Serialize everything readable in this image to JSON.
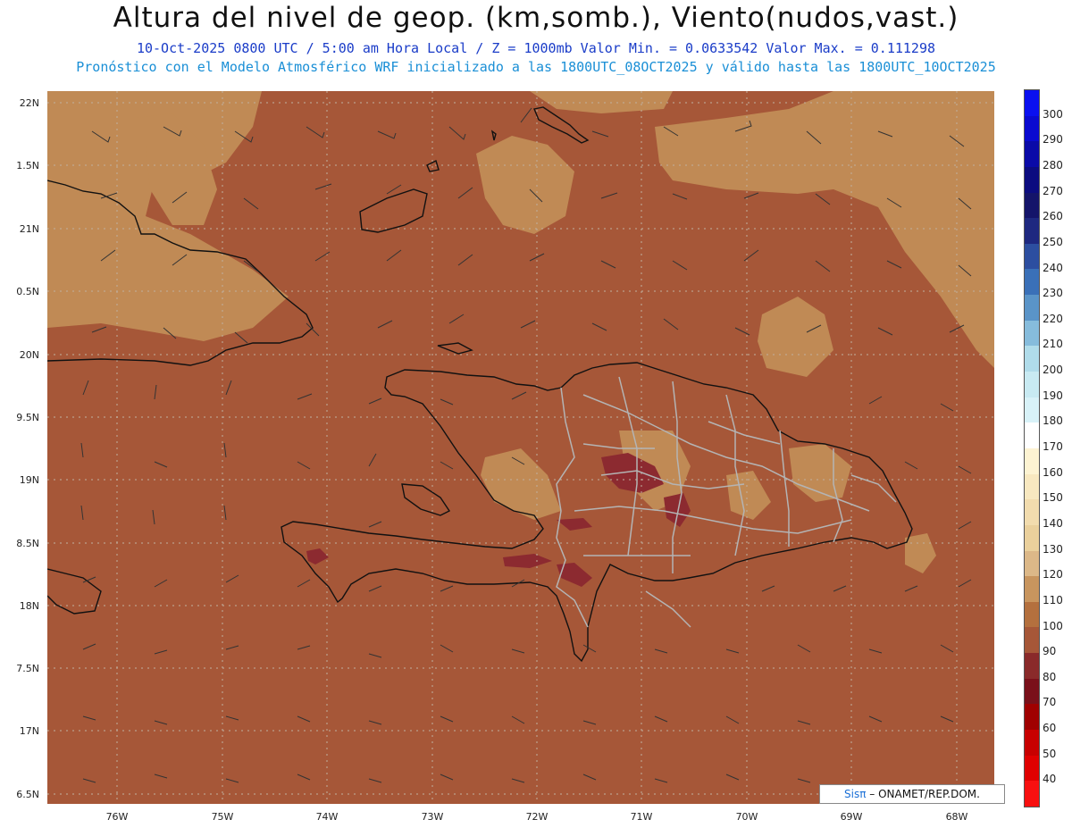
{
  "header": {
    "title": "Altura del nivel de geop. (km,somb.), Viento(nudos,vast.)",
    "subtitle_1": "10-Oct-2025  0800 UTC / 5:00 am Hora Local / Z = 1000mb  Valor Min. = 0.0633542  Valor Max. = 0.111298",
    "subtitle_2": "Pronóstico con el Modelo Atmosférico WRF inicializado a las 1800UTC_08OCT2025 y válido hasta las  1800UTC_10OCT2025"
  },
  "axes": {
    "lat_labels": [
      "22N",
      "1.5N",
      "21N",
      "0.5N",
      "20N",
      "9.5N",
      "19N",
      "8.5N",
      "18N",
      "7.5N",
      "17N",
      "6.5N"
    ],
    "lon_labels": [
      "76W",
      "75W",
      "74W",
      "73W",
      "72W",
      "71W",
      "70W",
      "69W",
      "68W"
    ]
  },
  "colorbar": {
    "labels": [
      "300",
      "290",
      "280",
      "270",
      "260",
      "250",
      "240",
      "230",
      "220",
      "210",
      "200",
      "190",
      "180",
      "170",
      "160",
      "150",
      "140",
      "130",
      "120",
      "110",
      "100",
      "90",
      "80",
      "70",
      "60",
      "50",
      "40"
    ],
    "colors": [
      "#0a10f0",
      "#0a0ad0",
      "#0a0aa8",
      "#0c0c80",
      "#14146a",
      "#1e2880",
      "#2c4ea0",
      "#3a70b8",
      "#5a94c8",
      "#86bcdc",
      "#b0dcea",
      "#c8eaf2",
      "#d8f2f8",
      "#ffffff",
      "#fdf3d2",
      "#f8e8c0",
      "#f2dcae",
      "#ead09c",
      "#dcb888",
      "#c8955e",
      "#b4703e",
      "#a65738",
      "#8a2a2a",
      "#7a101a",
      "#a00000",
      "#c80000",
      "#e00000",
      "#f81010"
    ]
  },
  "colors": {
    "sea_shade": "#a65738",
    "light_shade": "#c08a55",
    "dark_shade": "#8c2a30",
    "coast": "#111111",
    "province_border": "#b4b4b4"
  },
  "credit": {
    "sis": "Sisπ",
    "text": "– ONAMET/REP.DOM."
  }
}
